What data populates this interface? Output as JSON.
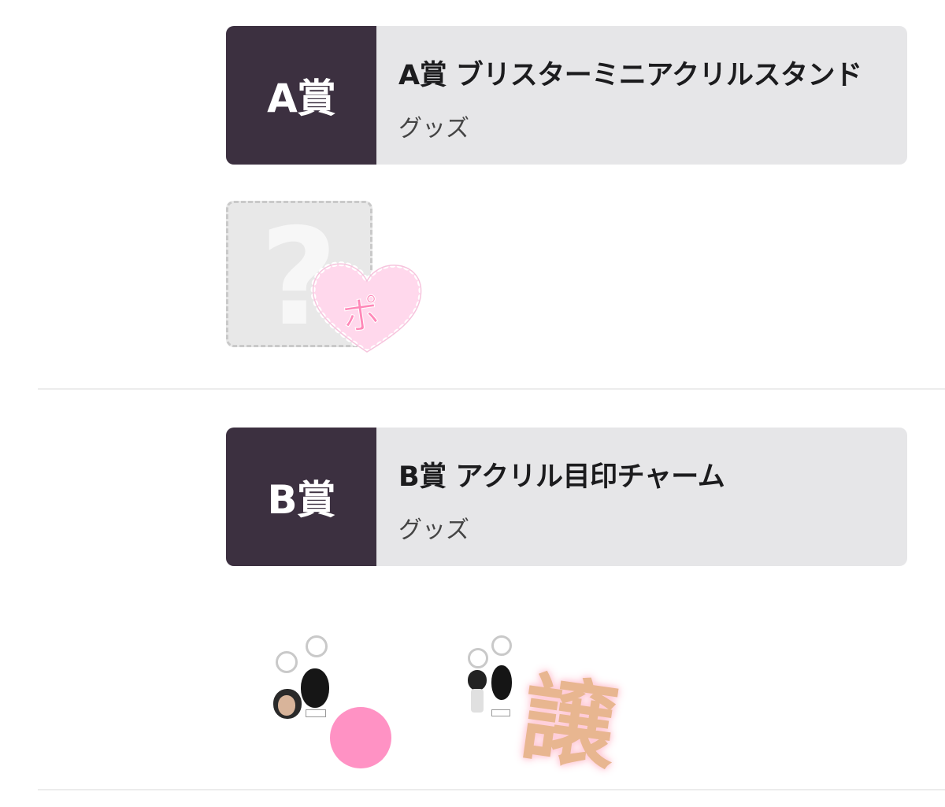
{
  "prizes": [
    {
      "badge": "A賞",
      "title": "A賞 ブリスターミニアクリルスタンド",
      "category": "グッズ",
      "sticker": "ポ"
    },
    {
      "badge": "B賞",
      "title": "B賞 アクリル目印チャーム",
      "category": "グッズ",
      "sticker": "譲"
    }
  ],
  "colors": {
    "badge_bg": "#3c3040",
    "card_bg": "#e6e6e8",
    "heart_pink": "#ffd8ec",
    "dot_pink": "#ff92c4",
    "stamp_gold": "#e8b690"
  },
  "icons": {
    "placeholder": "question-mark-icon",
    "heart": "heart-sticker-icon"
  }
}
